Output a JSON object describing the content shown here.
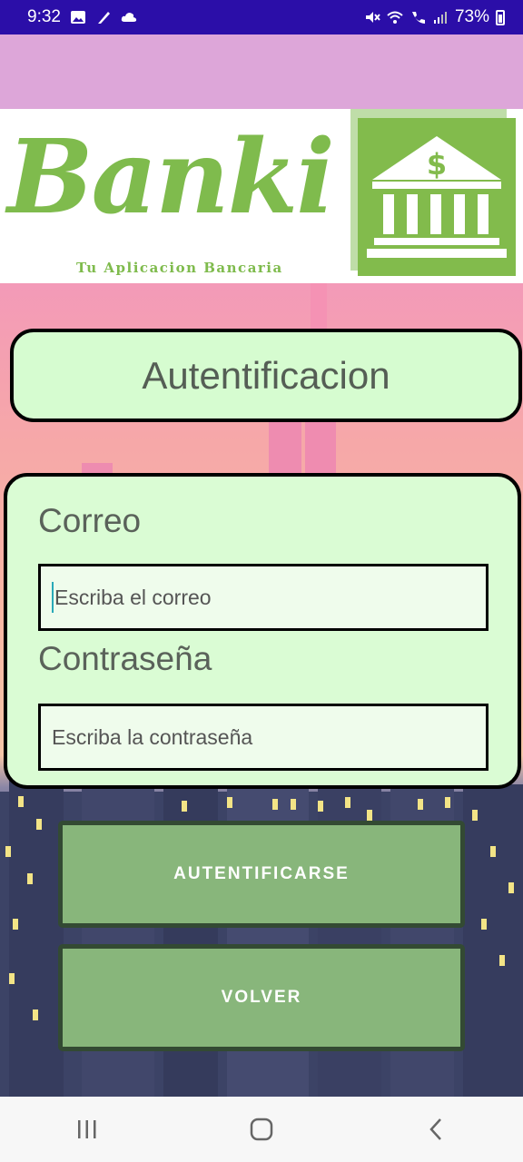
{
  "status_bar": {
    "time": "9:32",
    "battery": "73%",
    "icons": [
      "image-icon",
      "feather-icon",
      "cloud-icon",
      "mute-icon",
      "wifi-icon",
      "call-icon",
      "signal-icon",
      "battery-icon"
    ]
  },
  "banner": {
    "brand": "Banki",
    "tagline": "Tu Aplicacion Bancaria",
    "logo_icon": "bank-building-dollar-icon",
    "brand_color": "#7fbb4d"
  },
  "title": "Autentificacion",
  "form": {
    "email_label": "Correo",
    "email_placeholder": "Escriba el correo",
    "password_label": "Contraseña",
    "password_placeholder": "Escriba la contraseña"
  },
  "buttons": {
    "login": "AUTENTIFICARSE",
    "back": "VOLVER"
  },
  "nav": {
    "icons": [
      "recent-apps-icon",
      "home-icon",
      "back-icon"
    ]
  },
  "colors": {
    "status_bar": "#2b0ea8",
    "top_band": "#dda6d9",
    "card_bg": "#d6fcd0",
    "button_bg": "#88b67b",
    "button_border": "#334a33"
  }
}
